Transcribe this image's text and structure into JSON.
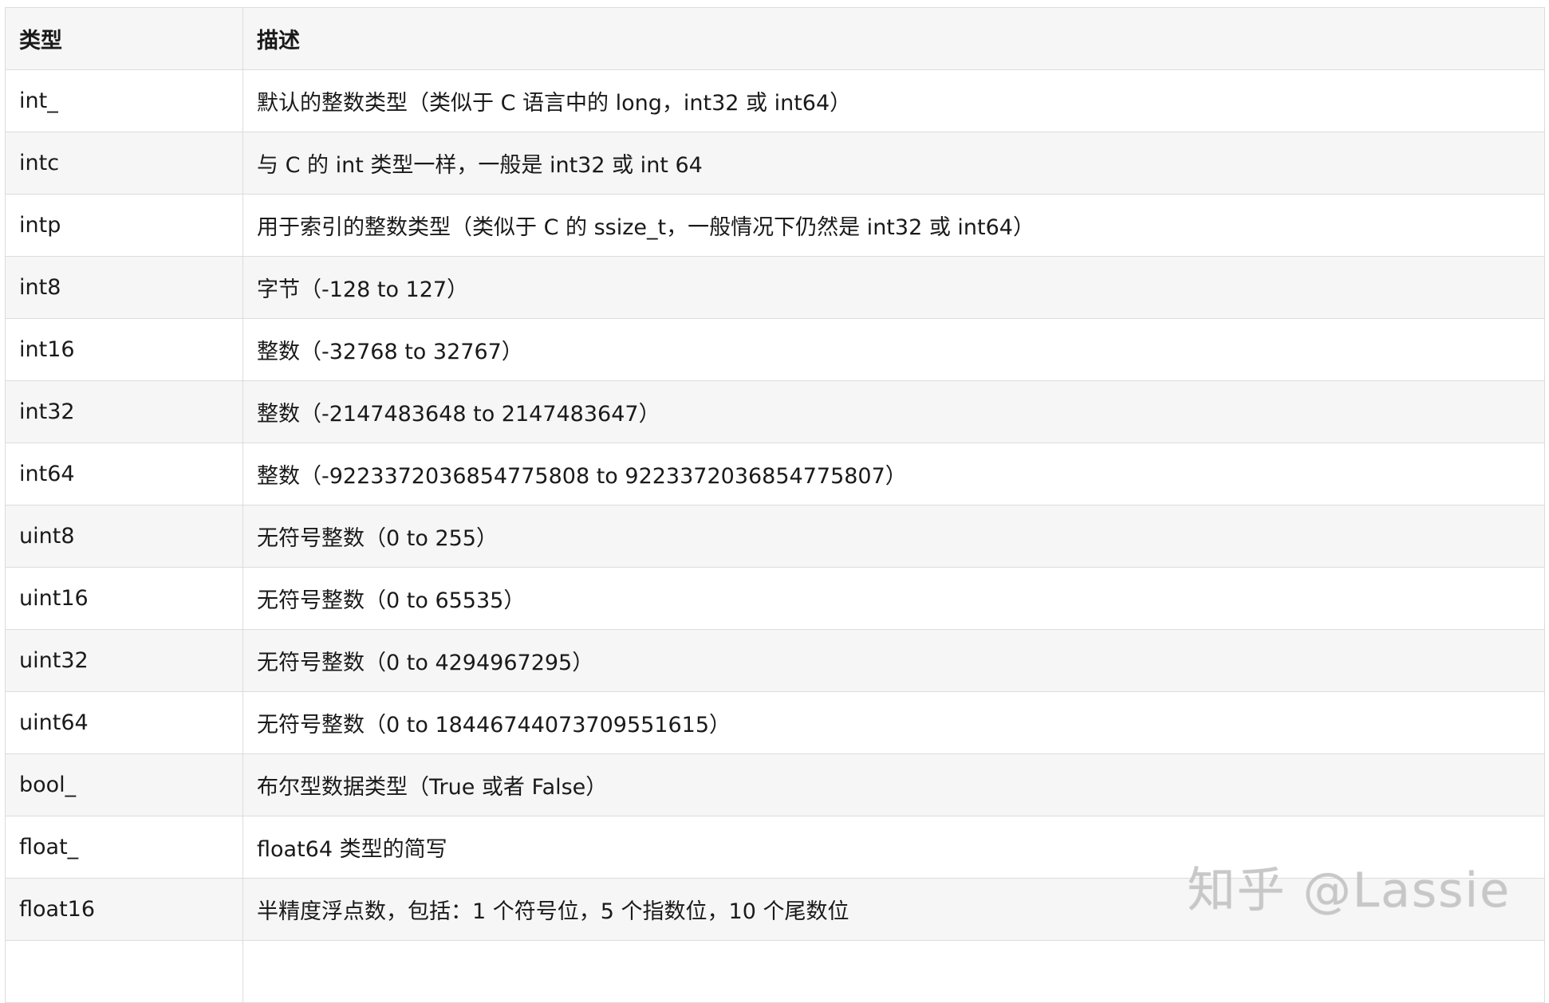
{
  "table": {
    "headers": [
      "类型",
      "描述"
    ],
    "rows": [
      [
        "int_",
        "默认的整数类型（类似于 C 语言中的 long，int32 或 int64）"
      ],
      [
        "intc",
        "与 C 的 int 类型一样，一般是 int32 或 int 64"
      ],
      [
        "intp",
        "用于索引的整数类型（类似于 C 的 ssize_t，一般情况下仍然是 int32 或 int64）"
      ],
      [
        "int8",
        "字节（-128 to 127）"
      ],
      [
        "int16",
        "整数（-32768 to 32767）"
      ],
      [
        "int32",
        "整数（-2147483648 to 2147483647）"
      ],
      [
        "int64",
        "整数（-9223372036854775808 to 9223372036854775807）"
      ],
      [
        "uint8",
        "无符号整数（0 to 255）"
      ],
      [
        "uint16",
        "无符号整数（0 to 65535）"
      ],
      [
        "uint32",
        "无符号整数（0 to 4294967295）"
      ],
      [
        "uint64",
        "无符号整数（0 to 18446744073709551615）"
      ],
      [
        "bool_",
        "布尔型数据类型（True 或者 False）"
      ],
      [
        "float_",
        "float64 类型的简写"
      ],
      [
        "float16",
        "半精度浮点数，包括：1 个符号位，5 个指数位，10 个尾数位"
      ],
      [
        "",
        ""
      ]
    ]
  },
  "watermark": "知乎 @Lassie"
}
